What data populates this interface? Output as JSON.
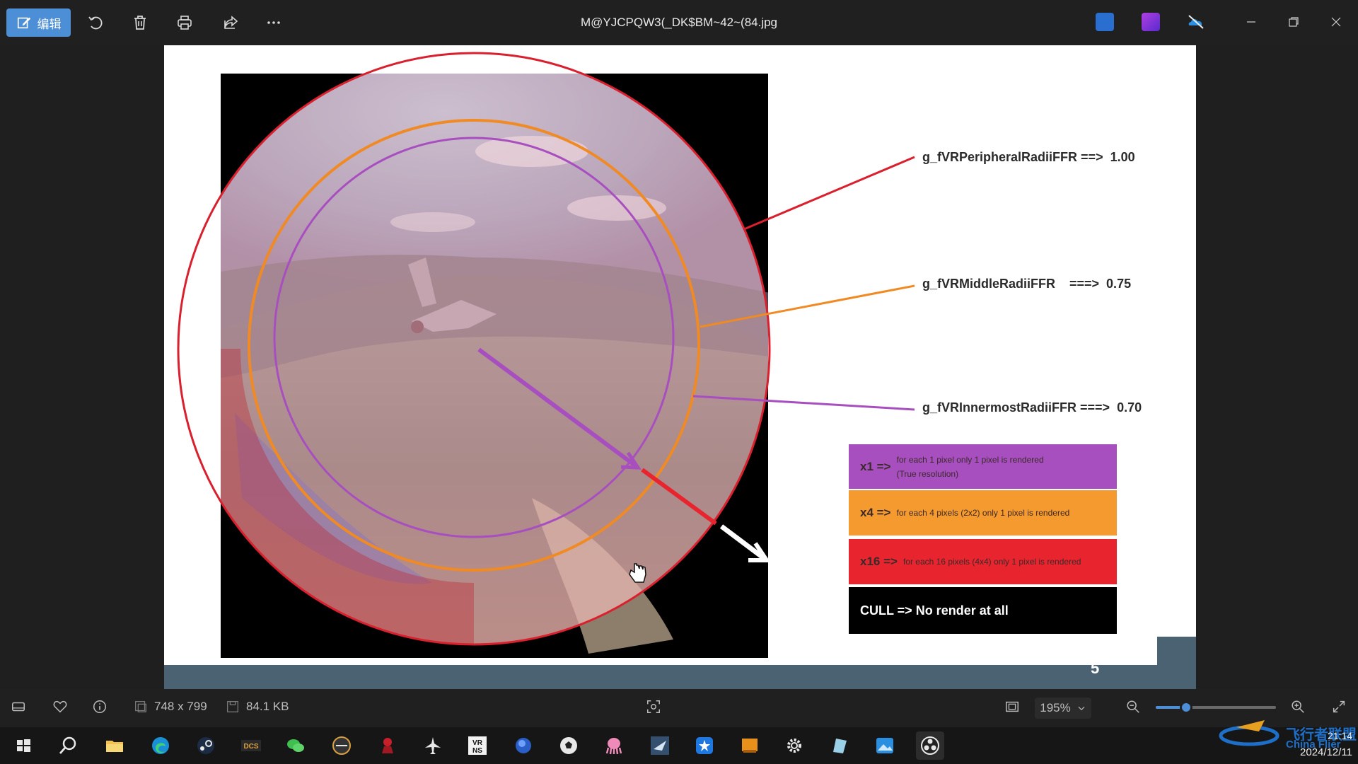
{
  "toolbar": {
    "edit_label": "编辑",
    "file_name": "M@YJCPQW3(_DK$BM~42~(84.jpg"
  },
  "slide": {
    "labels": {
      "peripheral": "g_fVRPeripheralRadiiFFR ==>  1.00",
      "middle": "g_fVRMiddleRadiiFFR    ===>  0.75",
      "innermost": "g_fVRInnermostRadiiFFR ===>  0.70"
    },
    "legend": [
      {
        "key": "x1 =>",
        "desc": "for each 1 pixel only 1 pixel is rendered",
        "desc2": "(True resolution)",
        "color": "#a84fc0"
      },
      {
        "key": "x4 =>",
        "desc": "for each 4 pixels (2x2) only 1 pixel is rendered",
        "desc2": "",
        "color": "#f59a2e"
      },
      {
        "key": "x16 =>",
        "desc": "for each 16 pixels (4x4) only 1 pixel is rendered",
        "desc2": "",
        "color": "#e8252e"
      },
      {
        "key": "CULL => No render at all",
        "desc": "",
        "desc2": "",
        "color": "#000000"
      }
    ],
    "page_number": "5",
    "ring_colors": {
      "outer": "#d9202e",
      "middle": "#f08a24",
      "inner": "#a84fc0"
    }
  },
  "status": {
    "dimensions": "748 x 799",
    "file_size": "84.1 KB",
    "zoom_label": "195%",
    "zoom_fraction": 0.25
  },
  "taskbar": {
    "apps": [
      "windows-start",
      "search",
      "file-explorer",
      "edge",
      "steam",
      "dcs",
      "wechat",
      "app-circle",
      "app-red",
      "aircraft",
      "vrns",
      "app-blue-circle",
      "app-ball",
      "app-octopus",
      "bms",
      "app-star",
      "app-orange",
      "settings",
      "app-tablet",
      "photos",
      "obs"
    ],
    "time": "21:14",
    "date": "2024/12/11"
  },
  "watermark": {
    "line1": "飞行者联盟",
    "line2": "China Flier"
  }
}
